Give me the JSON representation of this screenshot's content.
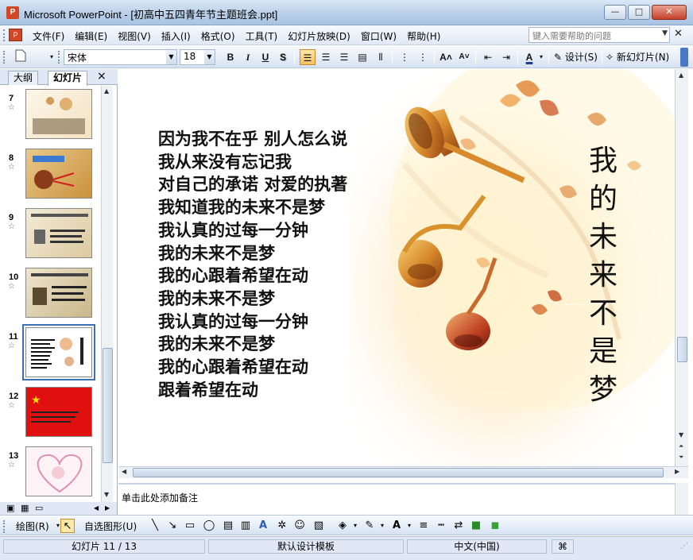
{
  "window": {
    "title": "Microsoft PowerPoint - [初高中五四青年节主题班会.ppt]",
    "app_icon": "P",
    "minimize": "—",
    "maximize": "□",
    "close": "✕"
  },
  "menu": {
    "items": [
      "文件(F)",
      "编辑(E)",
      "视图(V)",
      "插入(I)",
      "格式(O)",
      "工具(T)",
      "幻灯片放映(D)",
      "窗口(W)",
      "帮助(H)"
    ],
    "help_placeholder": "键入需要帮助的问题"
  },
  "toolbar": {
    "font_name": "宋体",
    "font_size": "18",
    "bold": "B",
    "italic": "I",
    "underline": "U",
    "shadow": "S",
    "design_label": "设计(S)",
    "new_slide_label": "新幻灯片(N)"
  },
  "left_pane": {
    "tab_outline": "大纲",
    "tab_slides": "幻灯片",
    "close": "×",
    "slide_numbers": [
      "7",
      "8",
      "9",
      "10",
      "11",
      "12",
      "13"
    ],
    "selected_slide": "11"
  },
  "slide": {
    "lyrics": [
      "因为我不在乎 别人怎么说",
      "我从来没有忘记我",
      "对自己的承诺 对爱的执著",
      "我知道我的未来不是梦",
      "我认真的过每一分钟",
      "我的未来不是梦",
      "我的心跟着希望在动",
      "我的未来不是梦",
      "我认真的过每一分钟",
      "我的未来不是梦",
      "我的心跟着希望在动",
      "跟着希望在动"
    ],
    "vertical_title": [
      "我",
      "的",
      "未",
      "来",
      "不",
      "是",
      "梦"
    ]
  },
  "notes": {
    "placeholder": "单击此处添加备注"
  },
  "drawbar": {
    "draw_label": "绘图(R)",
    "autoshape_label": "自选图形(U)"
  },
  "status": {
    "slide_pos": "幻灯片 11 / 13",
    "template": "默认设计模板",
    "language": "中文(中国)"
  },
  "colors": {
    "accent": "#3b6fb8",
    "titlebar": "#bcd2ea",
    "close_button": "#c7412c"
  }
}
